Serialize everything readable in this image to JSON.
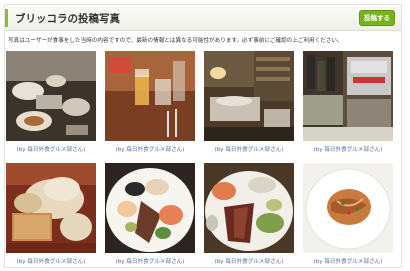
{
  "header": {
    "title": "ブリッコラの投稿写真",
    "post_button_label": "投稿する"
  },
  "notice": "写真はユーザーが食事をした当時の内容ですので、最新の情報とは異なる可能性があります。必ず事前にご確認の上ご利用ください。",
  "photos": [
    {
      "caption": "(by 毎日外食グルメ部さん)",
      "icon": "restaurant-table-photo"
    },
    {
      "caption": "(by 毎日外食グルメ部さん)",
      "icon": "drinks-on-table-photo"
    },
    {
      "caption": "(by 毎日外食グルメ部さん)",
      "icon": "dining-hall-photo"
    },
    {
      "caption": "(by 毎日外食グルメ部さん)",
      "icon": "wine-shelf-photo"
    },
    {
      "caption": "(by 毎日外食グルメ部さん)",
      "icon": "bread-basket-photo"
    },
    {
      "caption": "(by 毎日外食グルメ部さん)",
      "icon": "appetizer-plate-photo"
    },
    {
      "caption": "(by 毎日外食グルメ部さん)",
      "icon": "meat-salad-plate-photo"
    },
    {
      "caption": "(by 毎日外食グルメ部さん)",
      "icon": "pasta-plate-photo"
    }
  ]
}
